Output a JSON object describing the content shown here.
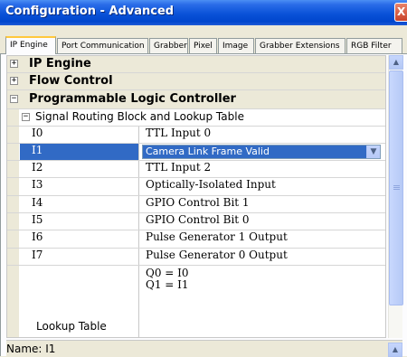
{
  "window": {
    "title": "Configuration - Advanced",
    "close_label": "X"
  },
  "tabs": [
    {
      "label": "IP Engine",
      "active": true
    },
    {
      "label": "Port Communication",
      "active": false
    },
    {
      "label": "Grabber",
      "active": false
    },
    {
      "label": "Pixel",
      "active": false
    },
    {
      "label": "Image",
      "active": false
    },
    {
      "label": "Grabber Extensions",
      "active": false
    },
    {
      "label": "RGB Filter",
      "active": false
    }
  ],
  "grid": {
    "categories": [
      {
        "label": "IP Engine",
        "expander": "+"
      },
      {
        "label": "Flow Control",
        "expander": "+"
      },
      {
        "label": "Programmable Logic Controller",
        "expander": "−"
      }
    ],
    "subcategory": {
      "label": "Signal Routing Block and Lookup Table",
      "expander": "−"
    },
    "properties": [
      {
        "name": "I0",
        "value": "TTL Input 0"
      },
      {
        "name": "I1",
        "value": "Camera Link Frame Valid"
      },
      {
        "name": "I2",
        "value": "TTL Input 2"
      },
      {
        "name": "I3",
        "value": "Optically-Isolated Input"
      },
      {
        "name": "I4",
        "value": "GPIO Control Bit 1"
      },
      {
        "name": "I5",
        "value": "GPIO Control Bit 0"
      },
      {
        "name": "I6",
        "value": "Pulse Generator 1 Output"
      },
      {
        "name": "I7",
        "value": "Pulse Generator 0 Output"
      }
    ],
    "lookup": {
      "name": "Lookup Table",
      "lines": [
        "Q0 = I0",
        "Q1 = I1"
      ]
    }
  },
  "status": {
    "label": "Name: I1"
  },
  "icons": {
    "dropdown_arrow": "chevron-down-icon",
    "scroll_up": "scroll-up-arrow-icon",
    "scroll_down": "scroll-down-arrow-icon"
  },
  "colors": {
    "selection": "#316ac5",
    "titlebar": "#0a52d8",
    "tab_highlight": "#ffc83c"
  }
}
